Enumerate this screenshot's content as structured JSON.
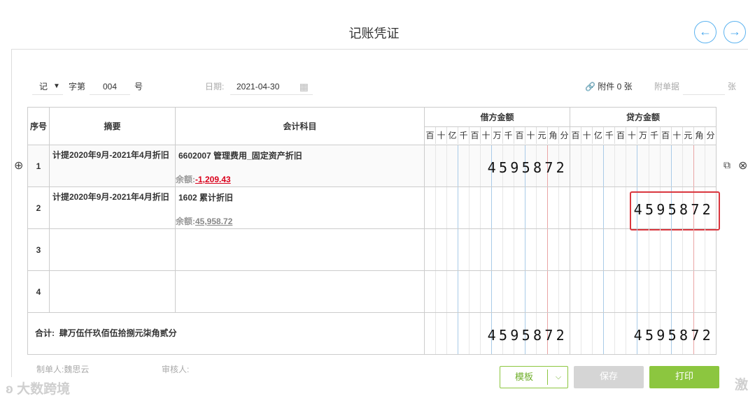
{
  "page": {
    "title": "记账凭证"
  },
  "header": {
    "voucher_type": "记",
    "zi_label": "字第",
    "number": "004",
    "hao_label": "号",
    "date_label": "日期:",
    "date_value": "2021-04-30",
    "attachment_label": "附件 0 张",
    "attach_doc_placeholder": "附单据",
    "zhang_label": "张"
  },
  "table": {
    "col_seq": "序号",
    "col_summary": "摘要",
    "col_account": "会计科目",
    "col_debit": "借方金额",
    "col_credit": "贷方金额",
    "unit_digits": [
      "百",
      "十",
      "亿",
      "千",
      "百",
      "十",
      "万",
      "千",
      "百",
      "十",
      "元",
      "角",
      "分"
    ],
    "balance_label": "余额:",
    "rows": [
      {
        "seq": "1",
        "summary": "计提2020年9月-2021年4月折旧",
        "account": "6602007 管理费用_固定资产折旧",
        "balance": "-1,209.43",
        "debit": "4595872",
        "credit": ""
      },
      {
        "seq": "2",
        "summary": "计提2020年9月-2021年4月折旧",
        "account": "1602 累计折旧",
        "balance": "45,958.72",
        "debit": "",
        "credit": "4595872"
      },
      {
        "seq": "3",
        "summary": "",
        "account": "",
        "balance": "",
        "debit": "",
        "credit": ""
      },
      {
        "seq": "4",
        "summary": "",
        "account": "",
        "balance": "",
        "debit": "",
        "credit": ""
      }
    ],
    "total_label": "合计:",
    "total_words": "肆万伍仟玖佰伍拾捌元柒角贰分",
    "total_debit": "4595872",
    "total_credit": "4595872"
  },
  "footer": {
    "preparer": "制单人:魏思云",
    "reviewer": "审核人:",
    "template_btn": "模板",
    "save_btn": "保存",
    "print_btn": "打印"
  },
  "watermark": {
    "brand": "大数跨境",
    "right_char": "激"
  },
  "colors": {
    "accent_green": "#8cc63f",
    "nav_blue": "#4aa8ee",
    "negative_red": "#d9001b",
    "highlight_red": "#d9363e"
  }
}
